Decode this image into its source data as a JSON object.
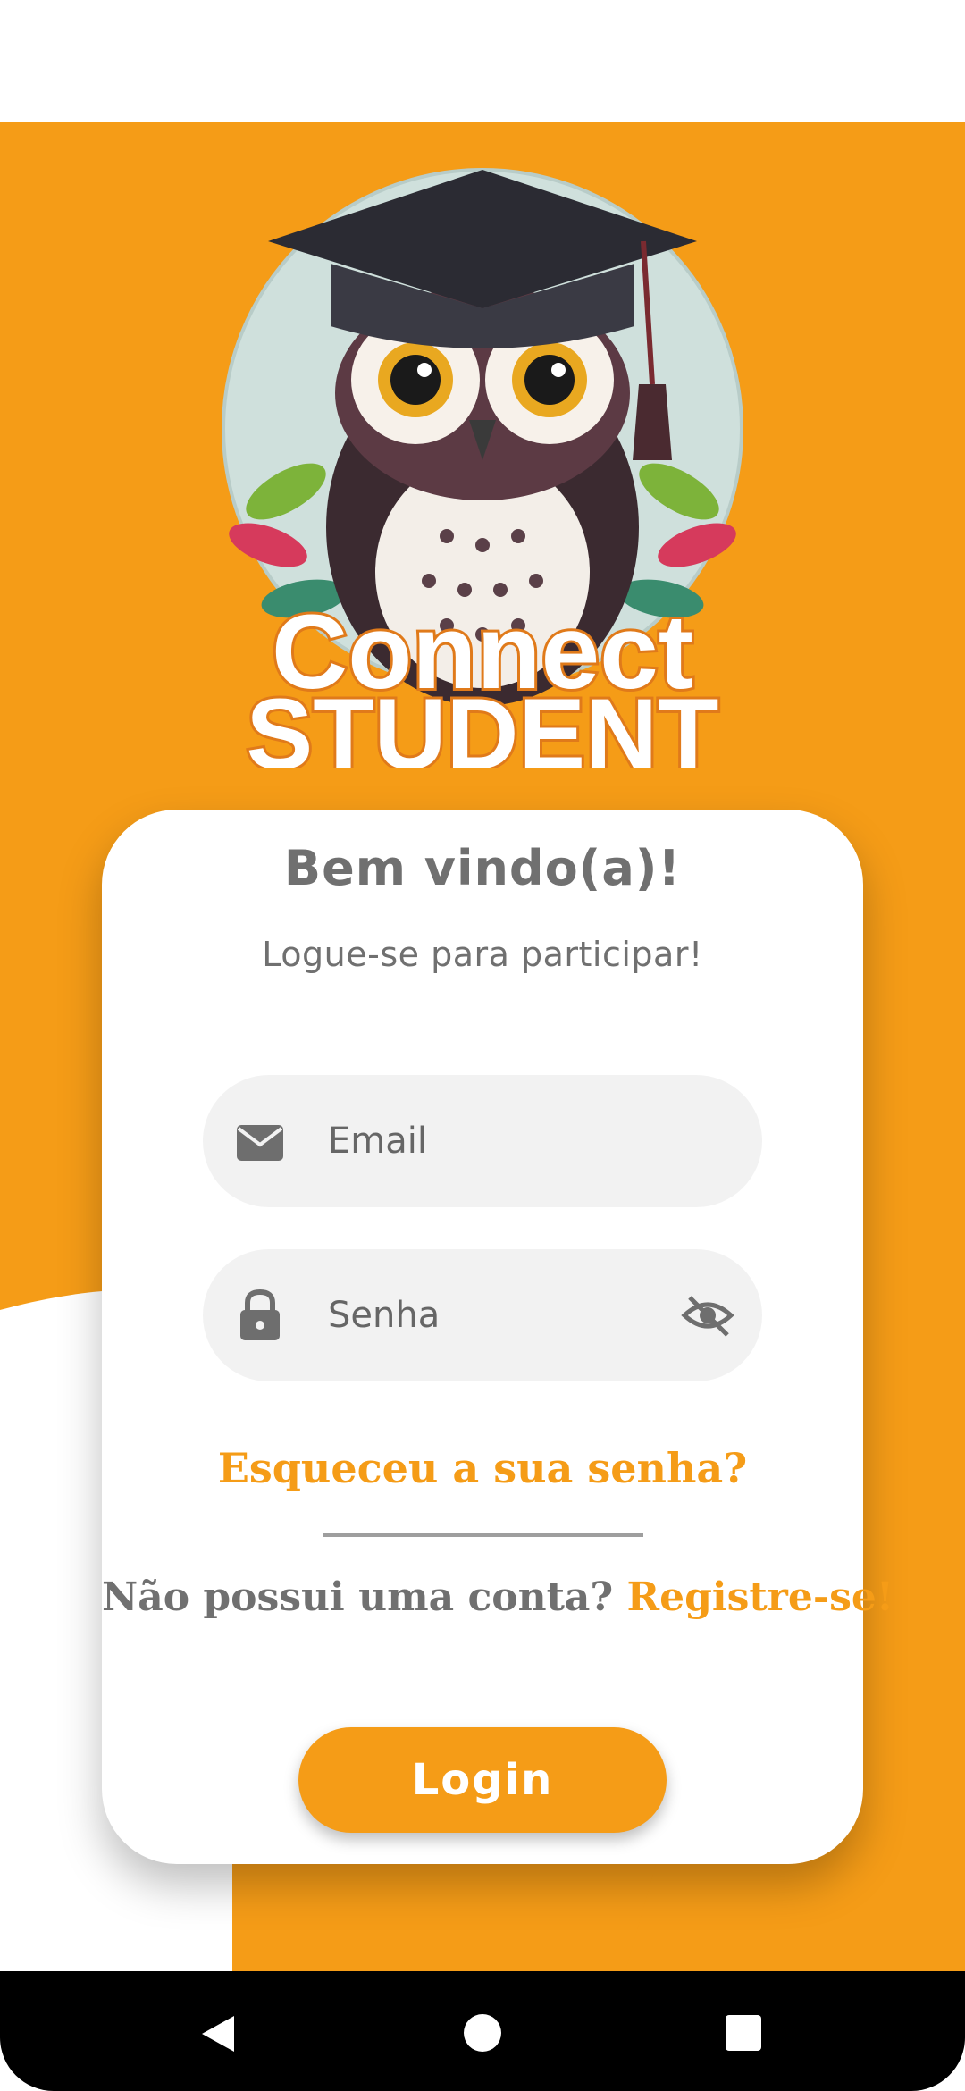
{
  "logo": {
    "line1": "Connect",
    "line2": "STUDENT"
  },
  "card": {
    "title": "Bem vindo(a)!",
    "subtitle": "Logue-se para participar!"
  },
  "email_field": {
    "placeholder": "Email",
    "value": "",
    "icon": "mail-icon"
  },
  "password_field": {
    "placeholder": "Senha",
    "value": "",
    "icon": "lock-icon",
    "toggle_icon": "eye-off-icon"
  },
  "forgot_password": "Esqueceu a sua senha?",
  "register": {
    "prompt": "Não possui uma conta?",
    "link": "Registre-se!"
  },
  "login_button": "Login",
  "navigation": {
    "back_icon": "back-triangle-icon",
    "home_icon": "home-circle-icon",
    "recents_icon": "recents-square-icon"
  },
  "colors": {
    "accent": "#F59C17",
    "text_gray": "#707070",
    "field_bg": "#F2F2F2"
  }
}
